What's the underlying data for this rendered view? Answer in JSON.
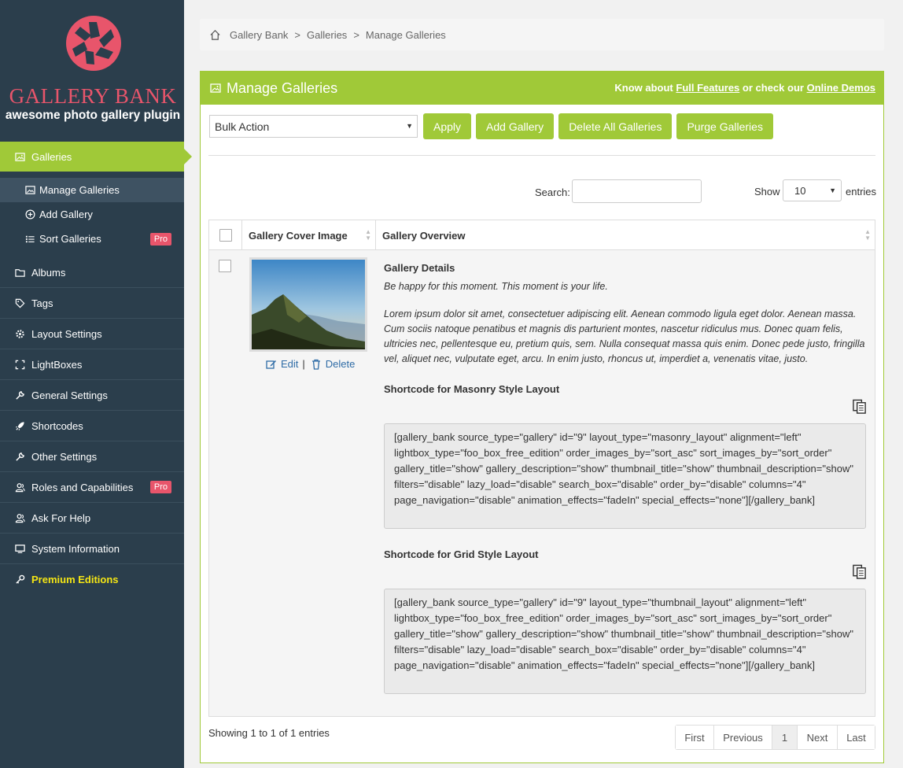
{
  "sidebar": {
    "brand_title": "GALLERY BANK",
    "brand_subtitle": "awesome photo gallery plugin",
    "items": [
      {
        "label": "Galleries"
      },
      {
        "label": "Albums"
      },
      {
        "label": "Tags"
      },
      {
        "label": "Layout Settings"
      },
      {
        "label": "LightBoxes"
      },
      {
        "label": "General Settings"
      },
      {
        "label": "Shortcodes"
      },
      {
        "label": "Other Settings"
      },
      {
        "label": "Roles and Capabilities",
        "badge": "Pro"
      },
      {
        "label": "Ask For Help"
      },
      {
        "label": "System Information"
      },
      {
        "label": "Premium Editions"
      }
    ],
    "subitems": [
      {
        "label": "Manage Galleries"
      },
      {
        "label": "Add Gallery"
      },
      {
        "label": "Sort Galleries",
        "badge": "Pro"
      }
    ],
    "colors": {
      "bg": "#2b3e4c",
      "accent": "#a0c938",
      "brand": "#e8556b",
      "premium": "#f5e614"
    }
  },
  "breadcrumb": [
    "Gallery Bank",
    "Galleries",
    "Manage Galleries"
  ],
  "breadcrumb_sep": ">",
  "panel": {
    "title": "Manage Galleries",
    "links_prefix": "Know about",
    "link_features": "Full Features",
    "links_middle": "or check our",
    "link_demos": "Online Demos"
  },
  "toolbar": {
    "bulk_action": "Bulk Action",
    "apply": "Apply",
    "add_gallery": "Add Gallery",
    "delete_all": "Delete All Galleries",
    "purge": "Purge Galleries"
  },
  "filters": {
    "search_label": "Search:",
    "search_value": "",
    "show_label": "Show",
    "show_value": "10",
    "entries_label": "entries"
  },
  "table": {
    "headers": [
      "Gallery Cover Image",
      "Gallery Overview"
    ],
    "row": {
      "edit": "Edit",
      "separator": "|",
      "delete": "Delete",
      "details_title": "Gallery Details",
      "tagline": "Be happy for this moment. This moment is your life.",
      "description": "Lorem ipsum dolor sit amet, consectetuer adipiscing elit. Aenean commodo ligula eget dolor. Aenean massa. Cum sociis natoque penatibus et magnis dis parturient montes, nascetur ridiculus mus. Donec quam felis, ultricies nec, pellentesque eu, pretium quis, sem. Nulla consequat massa quis enim. Donec pede justo, fringilla vel, aliquet nec, vulputate eget, arcu. In enim justo, rhoncus ut, imperdiet a, venenatis vitae, justo.",
      "masonry_title": "Shortcode for Masonry Style Layout",
      "masonry_code": "[gallery_bank source_type=\"gallery\" id=\"9\" layout_type=\"masonry_layout\" alignment=\"left\" lightbox_type=\"foo_box_free_edition\" order_images_by=\"sort_asc\" sort_images_by=\"sort_order\" gallery_title=\"show\" gallery_description=\"show\" thumbnail_title=\"show\" thumbnail_description=\"show\" filters=\"disable\" lazy_load=\"disable\" search_box=\"disable\" order_by=\"disable\" columns=\"4\" page_navigation=\"disable\" animation_effects=\"fadeIn\" special_effects=\"none\"][/gallery_bank]",
      "grid_title": "Shortcode for Grid Style Layout",
      "grid_code": "[gallery_bank source_type=\"gallery\" id=\"9\" layout_type=\"thumbnail_layout\" alignment=\"left\" lightbox_type=\"foo_box_free_edition\" order_images_by=\"sort_asc\" sort_images_by=\"sort_order\" gallery_title=\"show\" gallery_description=\"show\" thumbnail_title=\"show\" thumbnail_description=\"show\" filters=\"disable\" lazy_load=\"disable\" search_box=\"disable\" order_by=\"disable\" columns=\"4\" page_navigation=\"disable\" animation_effects=\"fadeIn\" special_effects=\"none\"][/gallery_bank]"
    }
  },
  "footer": {
    "showing": "Showing 1 to 1 of 1 entries",
    "pages": [
      "First",
      "Previous",
      "1",
      "Next",
      "Last"
    ]
  }
}
